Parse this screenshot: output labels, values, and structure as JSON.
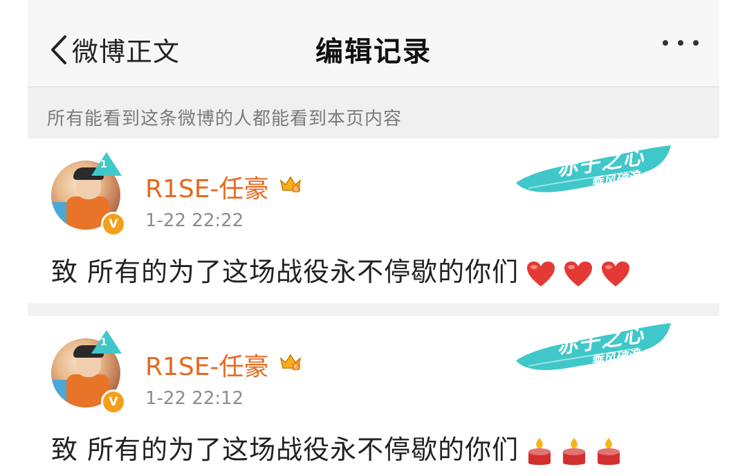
{
  "nav": {
    "back_label": "微博正文",
    "title": "编辑记录",
    "more_icon": "more-dots-icon"
  },
  "notice": {
    "text": "所有能看到这条微博的人都能看到本页内容"
  },
  "posts": [
    {
      "username": "R1SE-任豪",
      "timestamp": "1-22 22:22",
      "text": "致 所有的为了这场战役永不停歇的你们",
      "emoji_type": "heart",
      "emoji_count": 3,
      "badge_level": "1",
      "verified_label": "V",
      "promo_line1": "赤子之心",
      "promo_line2": "乘风破浪"
    },
    {
      "username": "R1SE-任豪",
      "timestamp": "1-22 22:12",
      "text": "致 所有的为了这场战役永不停歇的你们",
      "emoji_type": "candle",
      "emoji_count": 3,
      "badge_level": "1",
      "verified_label": "V",
      "promo_line1": "赤子之心",
      "promo_line2": "乘风破浪"
    }
  ],
  "colors": {
    "username": "#e8681f",
    "promo": "#3fc7c9",
    "heart": "#e53935",
    "candle_body": "#d32f2f",
    "flame": "#f6b41a"
  }
}
